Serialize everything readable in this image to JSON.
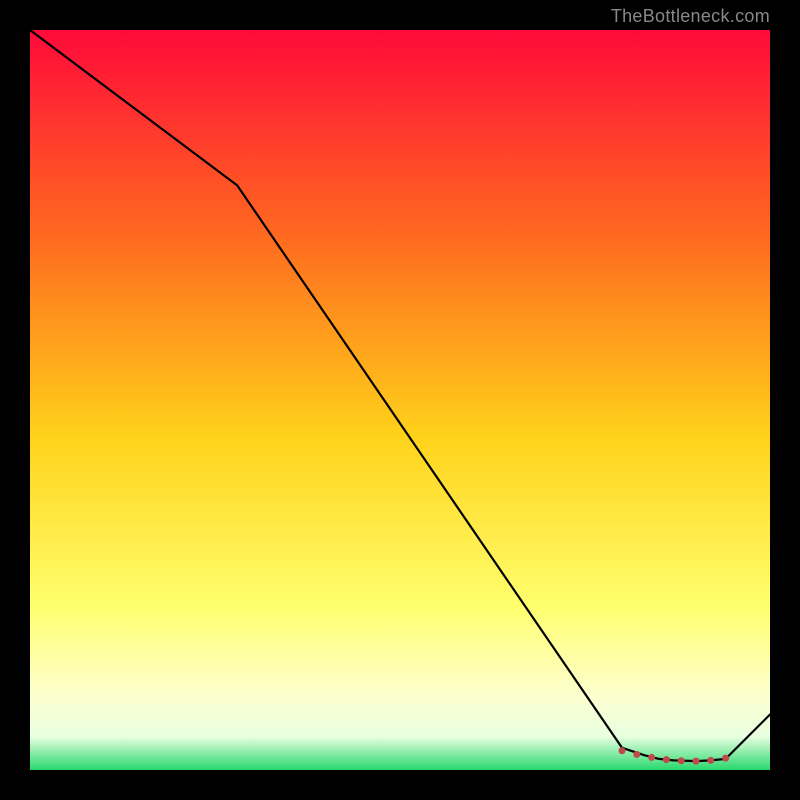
{
  "attribution": "TheBottleneck.com",
  "chart_data": {
    "type": "line",
    "title": "",
    "xlabel": "",
    "ylabel": "",
    "xlim": [
      0,
      100
    ],
    "ylim": [
      0,
      100
    ],
    "grid": false,
    "legend": false,
    "background_gradient_stops": [
      {
        "offset": 0.0,
        "color": "#ff0a3a"
      },
      {
        "offset": 0.28,
        "color": "#ff6a1f"
      },
      {
        "offset": 0.55,
        "color": "#ffd21a"
      },
      {
        "offset": 0.78,
        "color": "#ffff6e"
      },
      {
        "offset": 0.9,
        "color": "#fdffcf"
      },
      {
        "offset": 0.955,
        "color": "#e8ffe0"
      },
      {
        "offset": 1.0,
        "color": "#27d86d"
      }
    ],
    "series": [
      {
        "name": "bottleneck-curve",
        "x": [
          0,
          28,
          80,
          83,
          85,
          87,
          90,
          92,
          94,
          100
        ],
        "y": [
          100,
          79,
          3,
          2,
          1.5,
          1.3,
          1.2,
          1.3,
          1.5,
          7.5
        ]
      }
    ],
    "markers": {
      "name": "valley-markers",
      "color": "#c04a4a",
      "x": [
        80,
        82,
        84,
        86,
        88,
        90,
        92,
        94
      ],
      "y": [
        2.6,
        2.1,
        1.7,
        1.4,
        1.25,
        1.2,
        1.3,
        1.6
      ]
    }
  }
}
